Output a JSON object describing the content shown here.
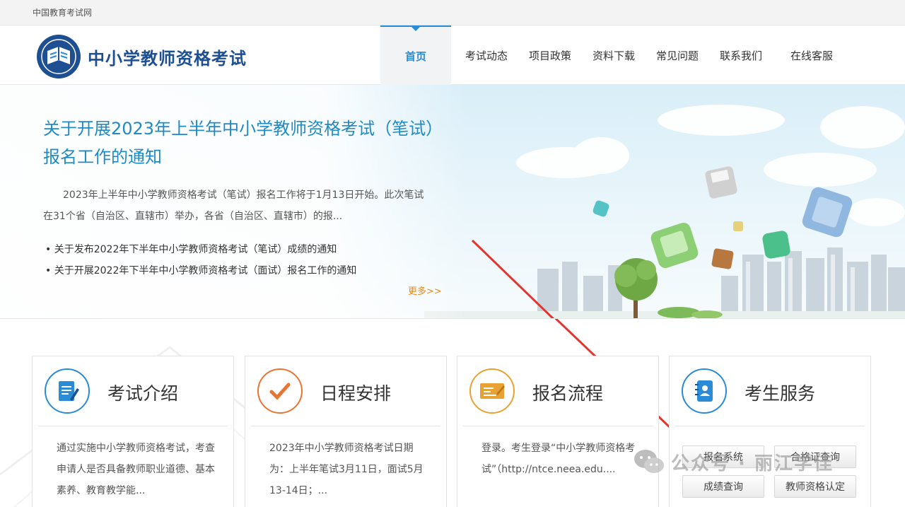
{
  "topbar": {
    "site_name": "中国教育考试网"
  },
  "header": {
    "brand": "中小学教师资格考试",
    "nav": [
      {
        "label": "首页",
        "active": true
      },
      {
        "label": "考试动态"
      },
      {
        "label": "项目政策"
      },
      {
        "label": "资料下载"
      },
      {
        "label": "常见问题"
      },
      {
        "label": "联系我们"
      },
      {
        "label": "在线客服"
      }
    ]
  },
  "banner": {
    "title": "关于开展2023年上半年中小学教师资格考试（笔试）报名工作的通知",
    "desc": "2023年上半年中小学教师资格考试（笔试）报名工作将于1月13日开始。此次笔试在31个省（自治区、直辖市）举办，各省（自治区、直辖市）的报...",
    "news": [
      "关于发布2022年下半年中小学教师资格考试（笔试）成绩的通知",
      "关于开展2022年下半年中小学教师资格考试（面试）报名工作的通知"
    ],
    "more": "更多>>"
  },
  "cards": [
    {
      "title": "考试介绍",
      "icon": "document-icon",
      "text": "通过实施中小学教师资格考试，考查申请人是否具备教师职业道德、基本素养、教育教学能..."
    },
    {
      "title": "日程安排",
      "icon": "check-icon",
      "text": "2023年中小学教师资格考试日期为：上半年笔试3月11日，面试5月13-14日；..."
    },
    {
      "title": "报名流程",
      "icon": "form-icon",
      "text": "登录。考生登录“中小学教师资格考试”（http://ntce.neea.edu...."
    },
    {
      "title": "考生服务",
      "icon": "contacts-icon"
    }
  ],
  "services": {
    "signup": "报名系统",
    "cert_query": "合格证查询",
    "score_query": "成绩查询",
    "qualification": "教师资格认定"
  },
  "watermark": {
    "text": "公众号 · 丽江学佳"
  },
  "colors": {
    "brand": "#1e4f92",
    "accent": "#2a8bd6",
    "link": "#1f8ac4",
    "more": "#e98a1a",
    "arrow": "#e3342f"
  }
}
